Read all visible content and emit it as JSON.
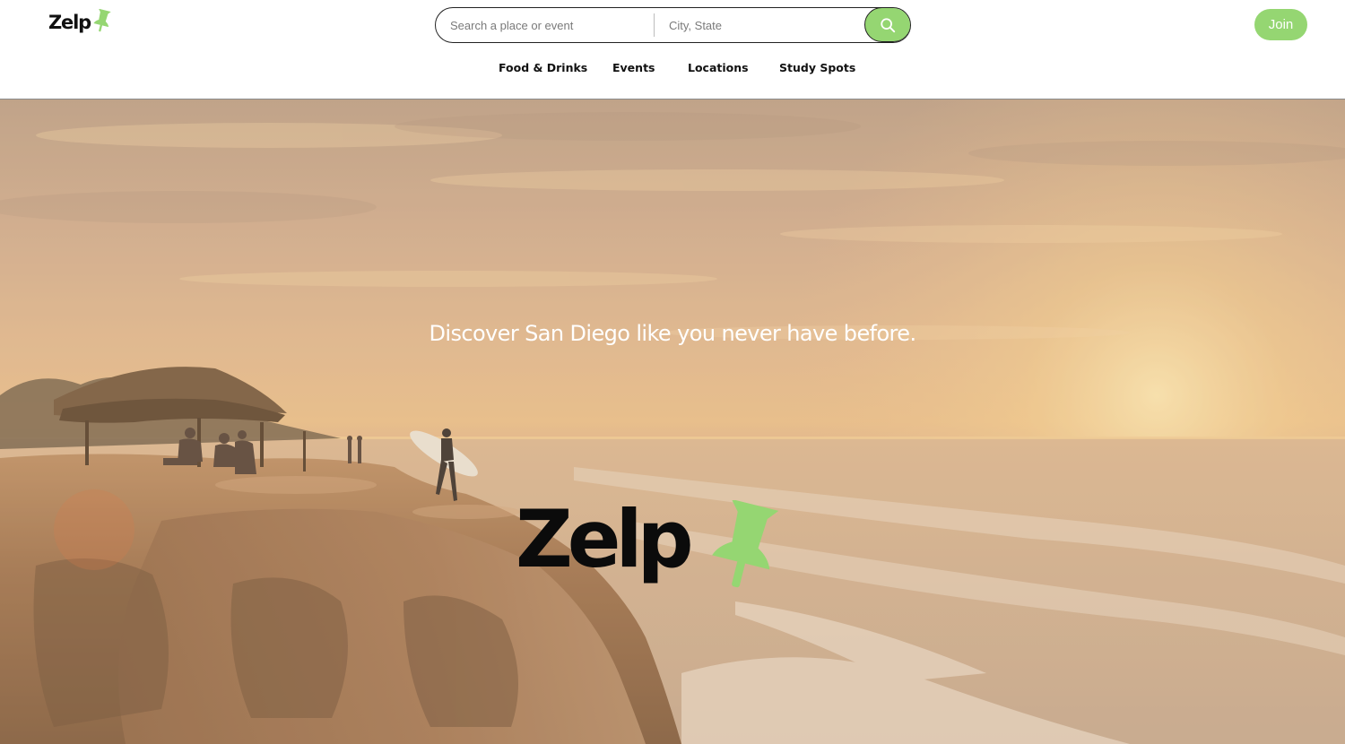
{
  "brand": {
    "name": "Zelp",
    "accent": "#95d672",
    "text_color": "#111111"
  },
  "search": {
    "what_placeholder": "Search a place or event",
    "where_placeholder": "City, State",
    "button_icon": "search-icon"
  },
  "header": {
    "join_label": "Join"
  },
  "nav": {
    "items": [
      "Food & Drinks",
      "Events",
      "Locations",
      "Study Spots"
    ]
  },
  "hero": {
    "tagline": "Discover San Diego like you never have before.",
    "logo_text": "Zelp",
    "logo_icon": "pushpin-icon"
  }
}
